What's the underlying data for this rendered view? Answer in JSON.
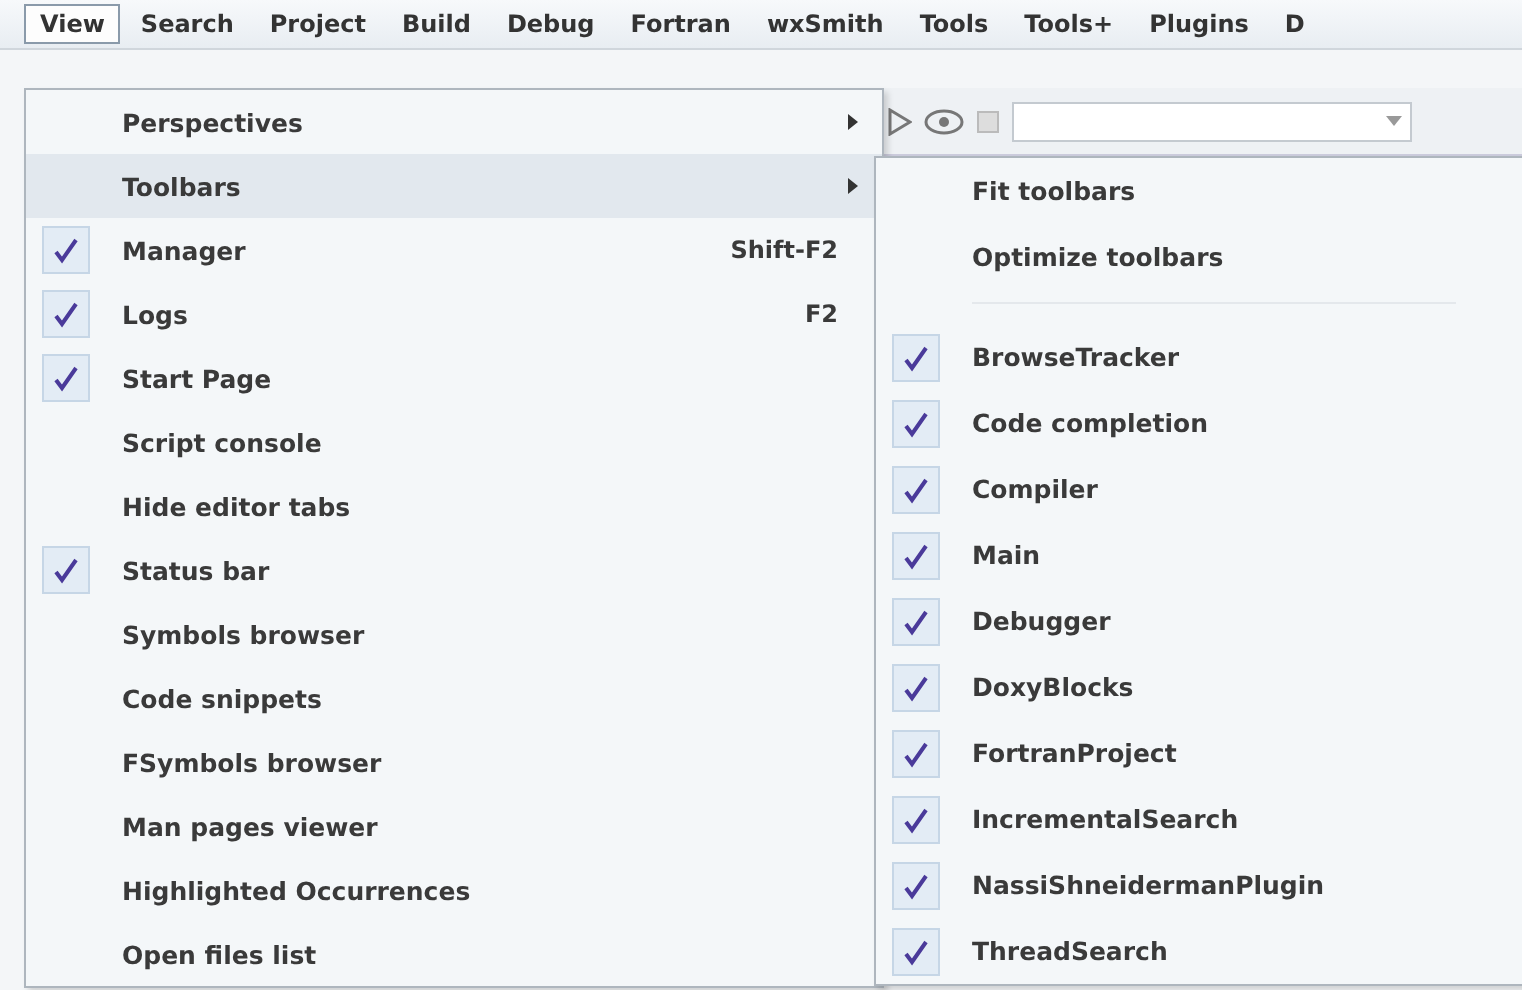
{
  "menubar": [
    {
      "label": "View",
      "selected": true
    },
    {
      "label": "Search",
      "selected": false
    },
    {
      "label": "Project",
      "selected": false
    },
    {
      "label": "Build",
      "selected": false
    },
    {
      "label": "Debug",
      "selected": false
    },
    {
      "label": "Fortran",
      "selected": false
    },
    {
      "label": "wxSmith",
      "selected": false
    },
    {
      "label": "Tools",
      "selected": false
    },
    {
      "label": "Tools+",
      "selected": false
    },
    {
      "label": "Plugins",
      "selected": false
    },
    {
      "label": "D",
      "selected": false
    }
  ],
  "view_menu": {
    "items": [
      {
        "label": "Perspectives",
        "checked": false,
        "submenu": true,
        "selected": false
      },
      {
        "label": "Toolbars",
        "checked": false,
        "submenu": true,
        "selected": true
      },
      {
        "label": "Manager",
        "checked": true,
        "shortcut": "Shift-F2",
        "submenu": false,
        "selected": false
      },
      {
        "label": "Logs",
        "checked": true,
        "shortcut": "F2",
        "submenu": false,
        "selected": false
      },
      {
        "label": "Start Page",
        "checked": true,
        "submenu": false,
        "selected": false
      },
      {
        "label": "Script console",
        "checked": false,
        "submenu": false,
        "selected": false
      },
      {
        "label": "Hide editor tabs",
        "checked": false,
        "submenu": false,
        "selected": false
      },
      {
        "label": "Status bar",
        "checked": true,
        "submenu": false,
        "selected": false
      },
      {
        "label": "Symbols browser",
        "checked": false,
        "submenu": false,
        "selected": false
      },
      {
        "label": "Code snippets",
        "checked": false,
        "submenu": false,
        "selected": false
      },
      {
        "label": "FSymbols browser",
        "checked": false,
        "submenu": false,
        "selected": false
      },
      {
        "label": "Man pages viewer",
        "checked": false,
        "submenu": false,
        "selected": false
      },
      {
        "label": "Highlighted Occurrences",
        "checked": false,
        "submenu": false,
        "selected": false
      },
      {
        "label": "Open files list",
        "checked": false,
        "submenu": false,
        "selected": false
      }
    ]
  },
  "toolbars_submenu": {
    "items": [
      {
        "kind": "item",
        "label": "Fit toolbars",
        "checked": false
      },
      {
        "kind": "item",
        "label": "Optimize toolbars",
        "checked": false
      },
      {
        "kind": "separator"
      },
      {
        "kind": "item",
        "label": "BrowseTracker",
        "checked": true
      },
      {
        "kind": "item",
        "label": "Code completion",
        "checked": true
      },
      {
        "kind": "item",
        "label": "Compiler",
        "checked": true
      },
      {
        "kind": "item",
        "label": "Main",
        "checked": true
      },
      {
        "kind": "item",
        "label": "Debugger",
        "checked": true
      },
      {
        "kind": "item",
        "label": "DoxyBlocks",
        "checked": true
      },
      {
        "kind": "item",
        "label": "FortranProject",
        "checked": true
      },
      {
        "kind": "item",
        "label": "IncrementalSearch",
        "checked": true
      },
      {
        "kind": "item",
        "label": "NassiShneidermanPlugin",
        "checked": true
      },
      {
        "kind": "item",
        "label": "ThreadSearch",
        "checked": true
      }
    ]
  }
}
